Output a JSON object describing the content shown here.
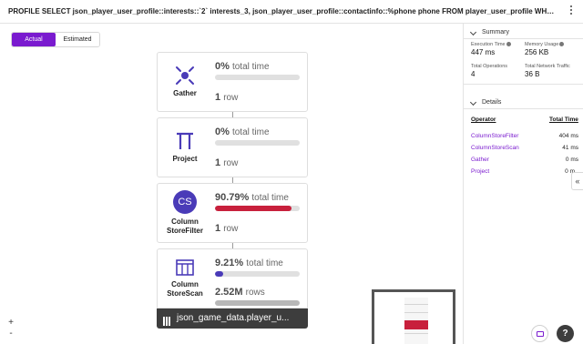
{
  "header": {
    "query": "PROFILE SELECT json_player_user_profile::interests::`2` interests_3, json_player_user_profile::contactinfo::%phone phone FROM player_user_profile WHERE json_player_use..."
  },
  "toggle": {
    "actual": "Actual",
    "estimated": "Estimated"
  },
  "plan": {
    "nodes": [
      {
        "label": "Gather",
        "icon": "gather-icon",
        "pct_value": "0%",
        "pct_unit": "total time",
        "time_fraction": 0.0,
        "rows_value": "1",
        "rows_unit": "row",
        "row_bar_fraction": null
      },
      {
        "label": "Project",
        "icon": "project-pi-icon",
        "pct_value": "0%",
        "pct_unit": "total time",
        "time_fraction": 0.0,
        "rows_value": "1",
        "rows_unit": "row",
        "row_bar_fraction": null
      },
      {
        "label_line1": "Column",
        "label_line2": "StoreFilter",
        "icon_text": "CS",
        "pct_value": "90.79%",
        "pct_unit": "total time",
        "time_fraction": 0.9079,
        "rows_value": "1",
        "rows_unit": "row",
        "row_bar_fraction": null
      },
      {
        "label_line1": "Column",
        "label_line2": "StoreScan",
        "icon": "columnstore-icon",
        "pct_value": "9.21%",
        "pct_unit": "total time",
        "time_fraction": 0.0921,
        "rows_value": "2.52M",
        "rows_unit": "rows",
        "row_bar_fraction": 1.0
      }
    ],
    "table_name": "json_game_data.player_u...",
    "zoom_in": "+",
    "zoom_out": "-"
  },
  "colors": {
    "accent": "#7a1bcf",
    "time_high": "#c8203c",
    "time_low": "#4a3bb8",
    "bar_track": "#e0e0e0",
    "rows_bar": "#b8b8b8"
  },
  "panel": {
    "summary_title": "Summary",
    "stats": [
      {
        "label": "Execution Time",
        "value": "447 ms"
      },
      {
        "label": "Memory Usage",
        "value": "256 KB"
      },
      {
        "label": "Total Operations",
        "value": "4"
      },
      {
        "label": "Total Network Traffic",
        "value": "36 B"
      }
    ],
    "details_title": "Details",
    "details_headers": {
      "operator": "Operator",
      "time": "Total Time"
    },
    "details_rows": [
      {
        "operator": "ColumnStoreFilter",
        "time": "404 ms"
      },
      {
        "operator": "ColumnStoreScan",
        "time": "41 ms"
      },
      {
        "operator": "Gather",
        "time": "0 ms"
      },
      {
        "operator": "Project",
        "time": "0 m"
      }
    ],
    "collapse_glyph": "«"
  },
  "fab": {
    "help": "?"
  }
}
